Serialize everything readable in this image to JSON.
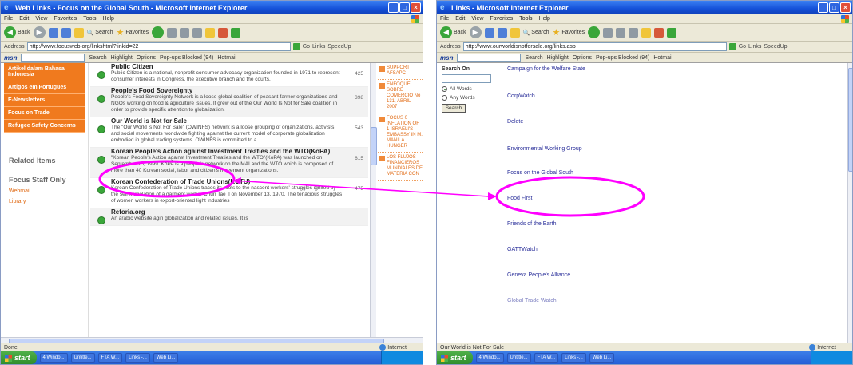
{
  "colors": {
    "annotation": "#ff00ff",
    "accent": "#f07a1e",
    "titlebar": "#1450d8",
    "link": "#2a2f9a"
  },
  "left": {
    "title": "Web Links - Focus on the Global South - Microsoft Internet Explorer",
    "menu": [
      "File",
      "Edit",
      "View",
      "Favorites",
      "Tools",
      "Help"
    ],
    "toolbar": {
      "back": "Back",
      "search": "Search",
      "favorites": "Favorites"
    },
    "address": {
      "label": "Address",
      "url": "http://www.focusweb.org/linkshtml?linkid=22",
      "go": "Go",
      "links": "Links",
      "speed": "SpeedUp"
    },
    "msnbar": {
      "logo": "msn",
      "search": "Search",
      "highlight": "Highlight",
      "options": "Options",
      "popup": "Pop-ups Blocked (94)",
      "hotmail": "Hotmail"
    },
    "sidebar": {
      "orange_items": [
        "Artikel dalam Bahasa Indonesia",
        "Artigos em Portugues",
        "E-Newsletters",
        "Focus on Trade",
        "Refugee Safety Concerns"
      ],
      "related_head": "Related Items",
      "staff_head": "Focus Staff Only",
      "staff_links": [
        "Webmail",
        "Library"
      ]
    },
    "rows": [
      {
        "title": "Public Citizen",
        "desc": "Public Citizen is a national, nonprofit consumer advocacy organization founded in 1971 to represent consumer interests in Congress, the executive branch and the courts.",
        "count": "425"
      },
      {
        "title": "People's Food Sovereignty",
        "desc": "People's Food Sovereignty Network is a loose global coalition of peasant-farmer organizations and NGOs working on food & agriculture issues. It grew out of the Our World Is Not for Sale coalition in order to provide specific attention to globalization.",
        "count": "398"
      },
      {
        "title": "Our World is Not for Sale",
        "desc": "The \"Our World is Not For Sale\" (OWINFS) network is a loose grouping of organizations, activists and social movements worldwide fighting against the current model of corporate globalization embodied in global trading systems. OWINFS is committed to a",
        "count": "543"
      },
      {
        "title": "Korean People's Action against Investment Treaties and the WTO(KoPA)",
        "desc": "\"Korean People's Action against Investment Treaties and the WTO\"(KoPA) was launched on September 15, 1999. KoPA is a people's network on the MAI and the WTO which is composed of more than 40 Korean social, labor and citizen's movement organizations.",
        "count": "615"
      },
      {
        "title": "Korean Confederation of Trade Unions(KCTU)",
        "desc": "Korean Confederation of Trade Unions traces its roots to the nascent workers' struggles ignited by the self-immolation of a garment worker Chun Tae Il on November 13, 1970. The tenacious struggles of women workers in export-oriented light industries",
        "count": "475"
      },
      {
        "title": "Reforia.org",
        "desc": "An arabic website agin globalization and related issues. It is",
        "count": ""
      }
    ],
    "news": [
      "SUPPORT AFSAPC",
      "ENFOQUE SOBRE COMERCIO No 131, ABRIL 2007",
      "FOCUS 0 INFLATION OF 1 ISRAELI'S EMBASSY IN M. MANILA HUNGER",
      "LOS FLUJOS FINANCIEROS MUNDIALES DE MATERIA CON"
    ],
    "status": "Done",
    "zone": "Internet",
    "taskbar": {
      "start": "start",
      "items": [
        "4 Windo...",
        "Untitle...",
        "FTA W...",
        "Links -...",
        "Web Li..."
      ]
    }
  },
  "right": {
    "title": "Links - Microsoft Internet Explorer",
    "menu": [
      "File",
      "Edit",
      "View",
      "Favorites",
      "Tools",
      "Help"
    ],
    "toolbar": {
      "back": "Back",
      "search": "Search",
      "favorites": "Favorites"
    },
    "address": {
      "label": "Address",
      "url": "http://www.ourworldisnotforsale.org/links.asp",
      "go": "Go",
      "links": "Links",
      "speed": "SpeedUp"
    },
    "msnbar": {
      "logo": "msn",
      "search": "Search",
      "highlight": "Highlight",
      "options": "Options",
      "popup": "Pop-ups Blocked (94)",
      "hotmail": "Hotmail"
    },
    "search_box": {
      "title": "Search On",
      "opt_all": "All Words",
      "opt_any": "Any Words",
      "button": "Search"
    },
    "links": [
      "Campaign for the Welfare State",
      "CorpWatch",
      "Delete",
      "Environmental Working Group",
      "Focus on the Global South",
      "Food First",
      "Friends of the Earth",
      "GATTWatch",
      "Geneva People's Alliance",
      "Global Trade Watch"
    ],
    "status": "Our World is Not For Sale",
    "zone": "Internet",
    "taskbar": {
      "start": "start",
      "items": [
        "4 Windo...",
        "Untitle...",
        "FTA W...",
        "Links -...",
        "Web Li..."
      ]
    }
  }
}
